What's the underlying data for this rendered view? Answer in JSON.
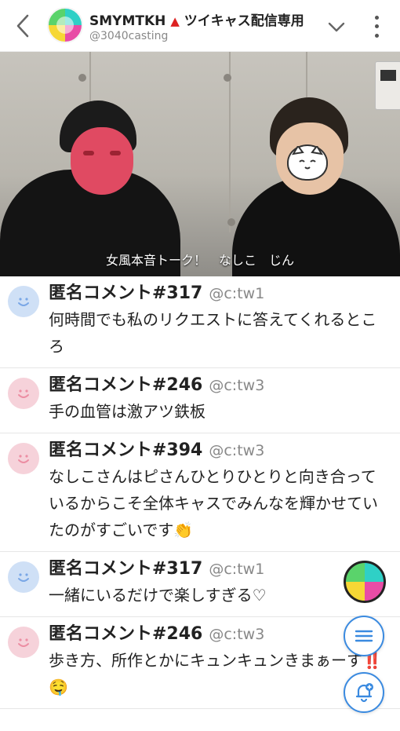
{
  "header": {
    "channel_name": "SMYMTKH",
    "channel_suffix": "ツイキャス配信専用",
    "handle": "@3040casting"
  },
  "video": {
    "caption": "女風本音トーク！　なしこ　じん"
  },
  "comments": [
    {
      "author": "匿名コメント#317",
      "handle": "@c:tw1",
      "text": "何時間でも私のリクエストに答えてくれるところ",
      "avatar": "blue"
    },
    {
      "author": "匿名コメント#246",
      "handle": "@c:tw3",
      "text": "手の血管は激アツ鉄板",
      "avatar": "pink"
    },
    {
      "author": "匿名コメント#394",
      "handle": "@c:tw3",
      "text": "なしこさんはピさんひとりひとりと向き合っているからこそ全体キャスでみんなを輝かせていたのがすごいです👏",
      "avatar": "pink"
    },
    {
      "author": "匿名コメント#317",
      "handle": "@c:tw1",
      "text": "一緒にいるだけで楽しすぎる♡",
      "avatar": "blue"
    },
    {
      "author": "匿名コメント#246",
      "handle": "@c:tw3",
      "text": "歩き方、所作とかにキュンキュンきまぁーす‼️🤤",
      "avatar": "pink"
    }
  ],
  "icons": {
    "back": "chevron-left-icon",
    "dropdown": "chevron-down-icon",
    "more": "more-vertical-icon",
    "menu": "list-icon",
    "notify": "bell-plus-icon",
    "avatar_face": "smiley-icon"
  },
  "colors": {
    "accent": "#3a8ae0",
    "avatar_blue": "#cfe0f6",
    "avatar_pink": "#f6d2da"
  }
}
